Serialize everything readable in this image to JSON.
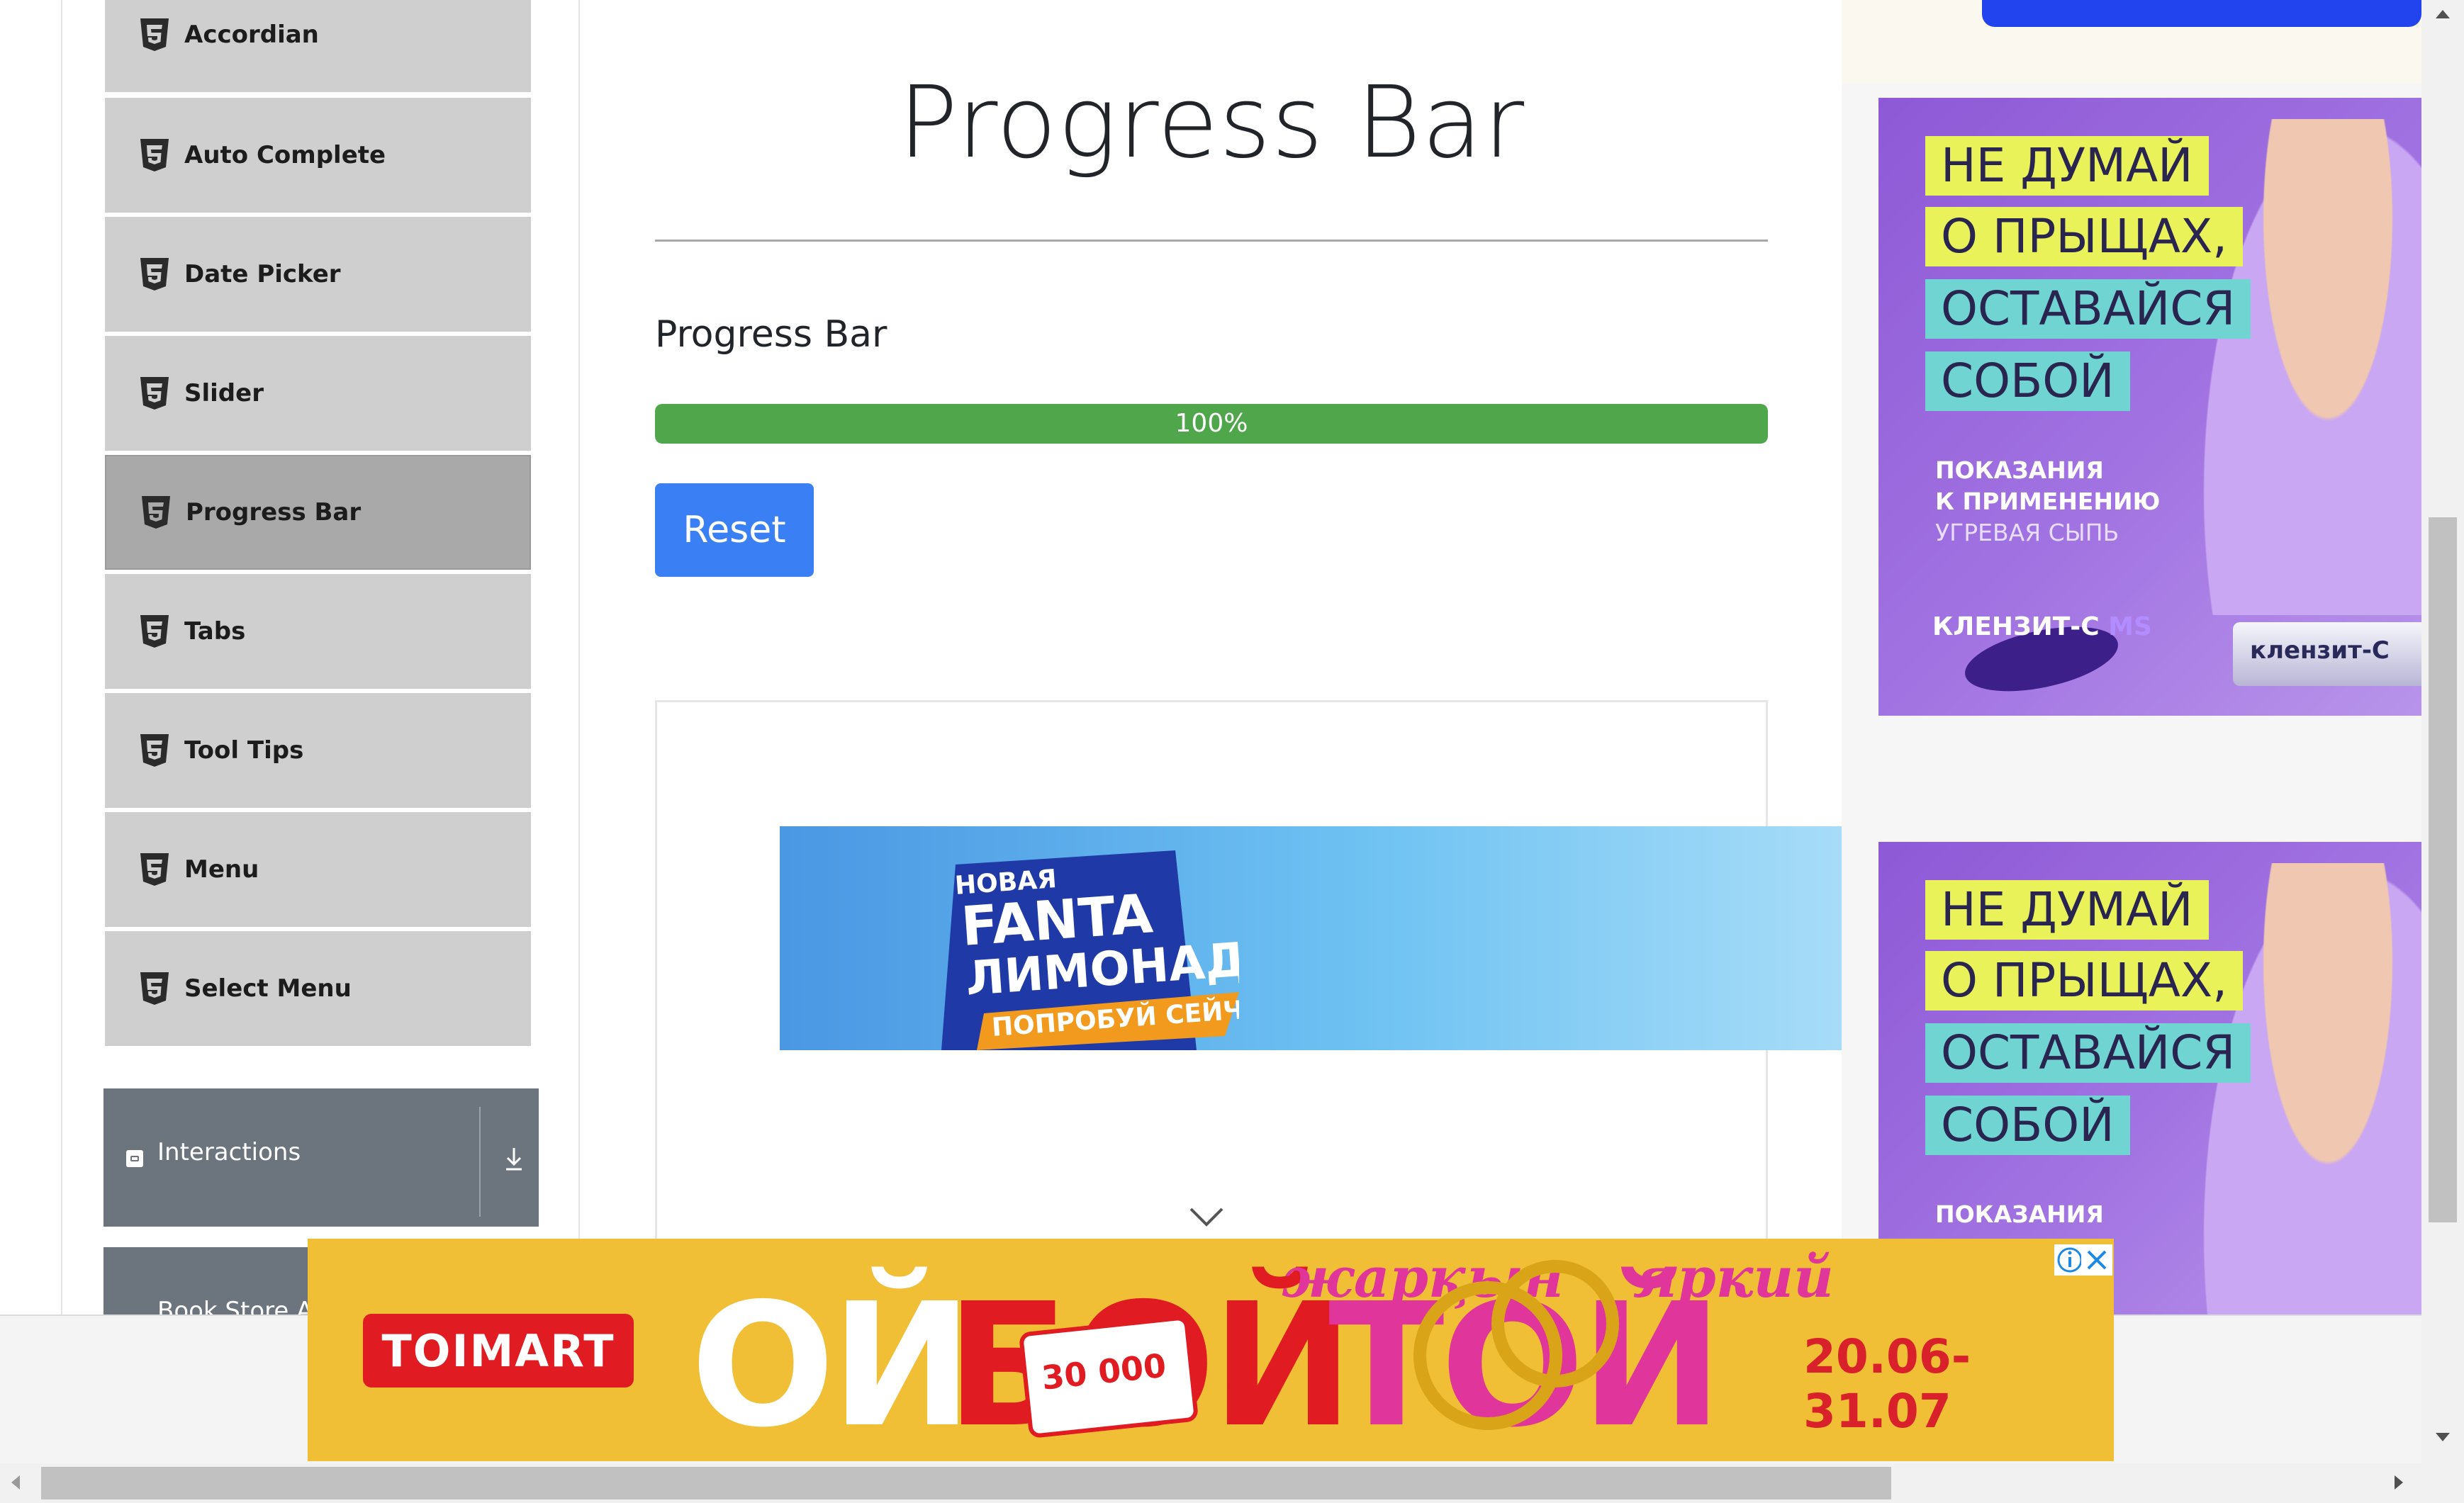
{
  "sidebar": {
    "items": [
      {
        "label": "Accordian"
      },
      {
        "label": "Auto Complete"
      },
      {
        "label": "Date Picker"
      },
      {
        "label": "Slider"
      },
      {
        "label": "Progress Bar"
      },
      {
        "label": "Tabs"
      },
      {
        "label": "Tool Tips"
      },
      {
        "label": "Menu"
      },
      {
        "label": "Select Menu"
      }
    ],
    "active_index": 4,
    "group_interactions": "Interactions",
    "group_book_store": "Book Store Application"
  },
  "main": {
    "page_title": "Progress Bar",
    "section_title": "Progress Bar",
    "progress": {
      "value_percent": 100,
      "label": "100%",
      "color": "#4fa64b"
    },
    "reset_label": "Reset"
  },
  "ads": {
    "fanta": {
      "line1": "НОВАЯ",
      "line2": "FANTA",
      "line3": "ЛИМОНАД",
      "line4": "ПОПРОБУЙ СЕЙЧАС!"
    },
    "klenzit": {
      "tag1": "НЕ ДУМАЙ",
      "tag2": "О ПРЫЩАХ,",
      "tag3": "ОСТАВАЙСЯ",
      "tag4": "СОБОЙ",
      "small1": "ПОКАЗАНИЯ",
      "small2": "К ПРИМЕНЕНИЮ",
      "small3": "УГРЕВАЯ СЫПЬ",
      "brand": "КЛЕНЗИТ-С",
      "brand_suffix": "MS",
      "tube_label": "клензит-С"
    },
    "toimart": {
      "logo": "TOIMART",
      "word1": "ОЙ",
      "word2": "БОЙ",
      "word3": "ТОЙ",
      "script1": "жарқын",
      "script2": "яркий",
      "badge": "30 000",
      "date": "20.06-31.07"
    }
  },
  "colors": {
    "accent_button": "#3b7ff5",
    "sidebar_item_bg": "#cfcfcf",
    "sidebar_active_bg": "#a9a9a9",
    "group_header_bg": "#6c747d"
  }
}
